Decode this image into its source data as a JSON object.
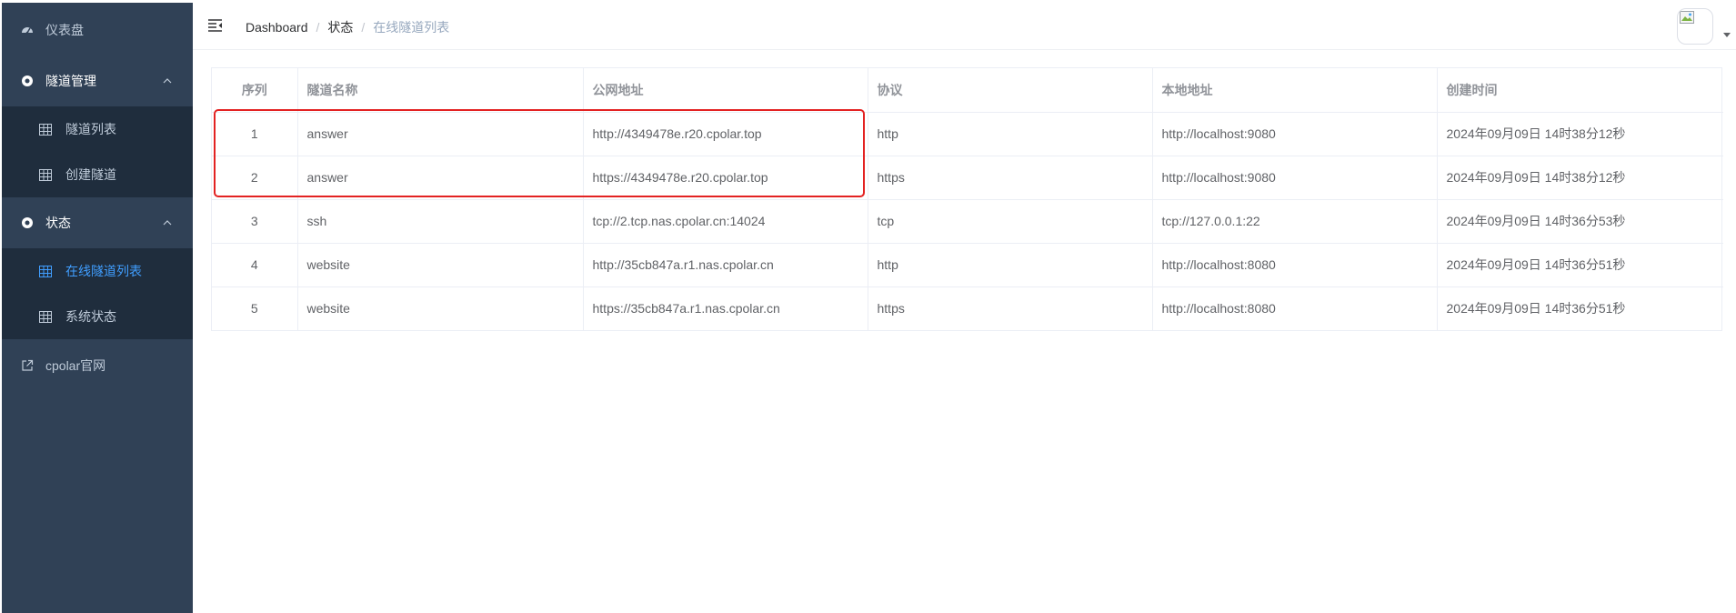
{
  "sidebar": {
    "dashboard": "仪表盘",
    "tunnel_mgmt": "隧道管理",
    "tunnel_list": "隧道列表",
    "create_tunnel": "创建隧道",
    "status": "状态",
    "online_tunnels": "在线隧道列表",
    "system_status": "系统状态",
    "cpolar_site": "cpolar官网",
    "colors": {
      "bg": "#304156",
      "submenu_bg": "#1f2d3d",
      "text": "#bfcbd9",
      "active": "#409eff"
    }
  },
  "header": {
    "breadcrumb": [
      "Dashboard",
      "状态",
      "在线隧道列表"
    ],
    "separator": "/"
  },
  "table": {
    "columns": [
      "序列",
      "隧道名称",
      "公网地址",
      "协议",
      "本地地址",
      "创建时间"
    ],
    "rows": [
      [
        "1",
        "answer",
        "http://4349478e.r20.cpolar.top",
        "http",
        "http://localhost:9080",
        "2024年09月09日 14时38分12秒"
      ],
      [
        "2",
        "answer",
        "https://4349478e.r20.cpolar.top",
        "https",
        "http://localhost:9080",
        "2024年09月09日 14时38分12秒"
      ],
      [
        "3",
        "ssh",
        "tcp://2.tcp.nas.cpolar.cn:14024",
        "tcp",
        "tcp://127.0.0.1:22",
        "2024年09月09日 14时36分53秒"
      ],
      [
        "4",
        "website",
        "http://35cb847a.r1.nas.cpolar.cn",
        "http",
        "http://localhost:8080",
        "2024年09月09日 14时36分51秒"
      ],
      [
        "5",
        "website",
        "https://35cb847a.r1.nas.cpolar.cn",
        "https",
        "http://localhost:8080",
        "2024年09月09日 14时36分51秒"
      ]
    ]
  },
  "annotation": {
    "color": "#e32222"
  }
}
